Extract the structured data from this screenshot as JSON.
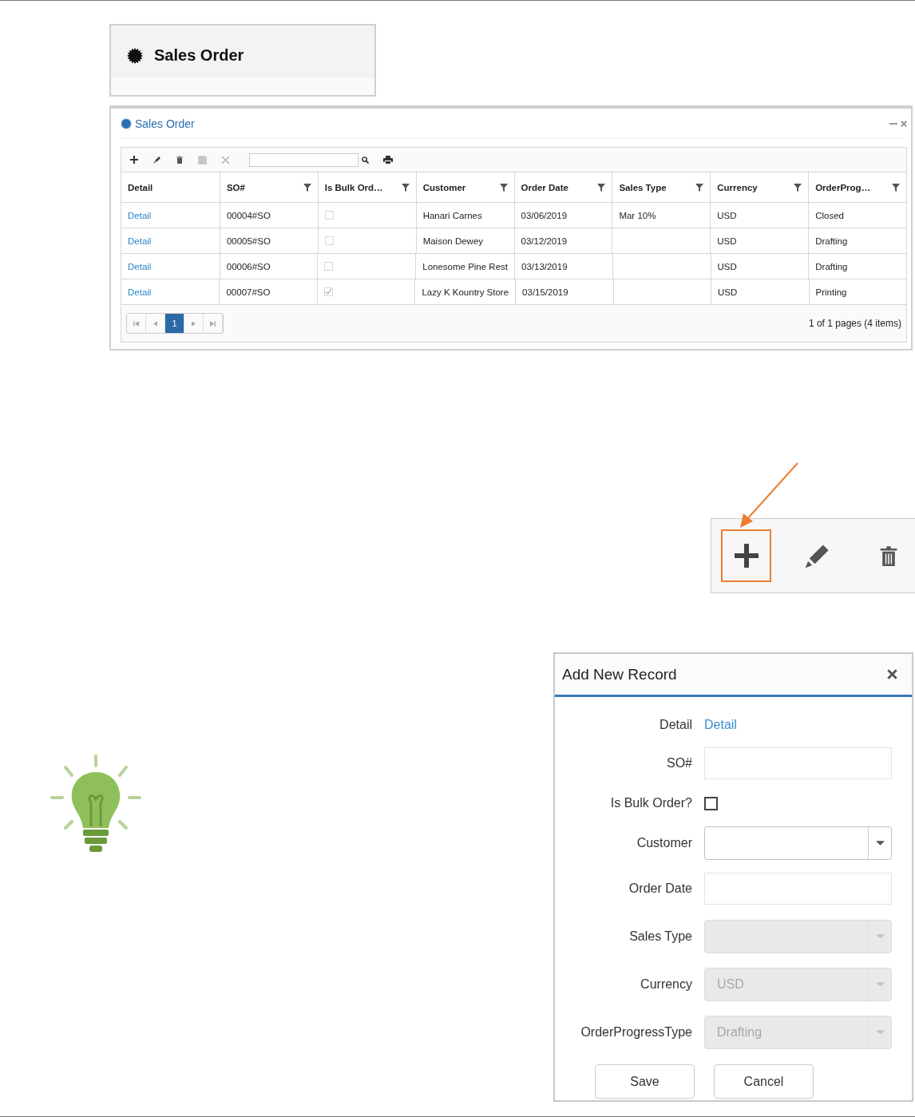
{
  "header_card": {
    "title": "Sales Order"
  },
  "grid_window": {
    "title": "Sales Order",
    "columns": [
      {
        "label": "Detail",
        "filterable": false
      },
      {
        "label": "SO#",
        "filterable": true
      },
      {
        "label": "Is Bulk Ord…",
        "filterable": true
      },
      {
        "label": "Customer",
        "filterable": true
      },
      {
        "label": "Order Date",
        "filterable": true
      },
      {
        "label": "Sales Type",
        "filterable": true
      },
      {
        "label": "Currency",
        "filterable": true
      },
      {
        "label": "OrderProg…",
        "filterable": true
      }
    ],
    "rows": [
      {
        "detail": "Detail",
        "so": "00004#SO",
        "bulk": false,
        "customer": "Hanari Carnes",
        "date": "03/06/2019",
        "sales_type": "Mar 10%",
        "currency": "USD",
        "progress": "Closed"
      },
      {
        "detail": "Detail",
        "so": "00005#SO",
        "bulk": false,
        "customer": "Maison Dewey",
        "date": "03/12/2019",
        "currency": "USD",
        "progress": "Drafting"
      },
      {
        "detail": "Detail",
        "so": "00006#SO",
        "bulk": false,
        "customer": "Lonesome Pine Rest",
        "date": "03/13/2019",
        "currency": "USD",
        "progress": "Drafting"
      },
      {
        "detail": "Detail",
        "so": "00007#SO",
        "bulk": true,
        "customer": "Lazy K Kountry Store",
        "date": "03/15/2019",
        "currency": "USD",
        "progress": "Printing"
      }
    ],
    "pager": {
      "pages": [
        {
          "label": "1",
          "selected": true
        }
      ],
      "info": "1 of 1 pages (4 items)"
    }
  },
  "zoomed_toolbar": {
    "items": [
      {
        "kind": "add",
        "highlighted": true
      },
      {
        "kind": "edit",
        "highlighted": false
      },
      {
        "kind": "delete",
        "highlighted": false
      }
    ]
  },
  "dialog": {
    "title": "Add New Record",
    "fields": [
      {
        "kind": "link",
        "label": "Detail",
        "value": "Detail"
      },
      {
        "kind": "text",
        "label": "SO#"
      },
      {
        "kind": "checkbox",
        "label": "Is Bulk Order?",
        "checked": false
      },
      {
        "kind": "combo",
        "label": "Customer",
        "disabled": false
      },
      {
        "kind": "text",
        "label": "Order Date"
      },
      {
        "kind": "combo",
        "label": "Sales Type",
        "disabled": true
      },
      {
        "kind": "combo",
        "label": "Currency",
        "value": "USD",
        "disabled": true
      },
      {
        "kind": "combo",
        "label": "OrderProgressType",
        "value": "Drafting",
        "disabled": true
      }
    ],
    "buttons": [
      "Save",
      "Cancel"
    ]
  }
}
